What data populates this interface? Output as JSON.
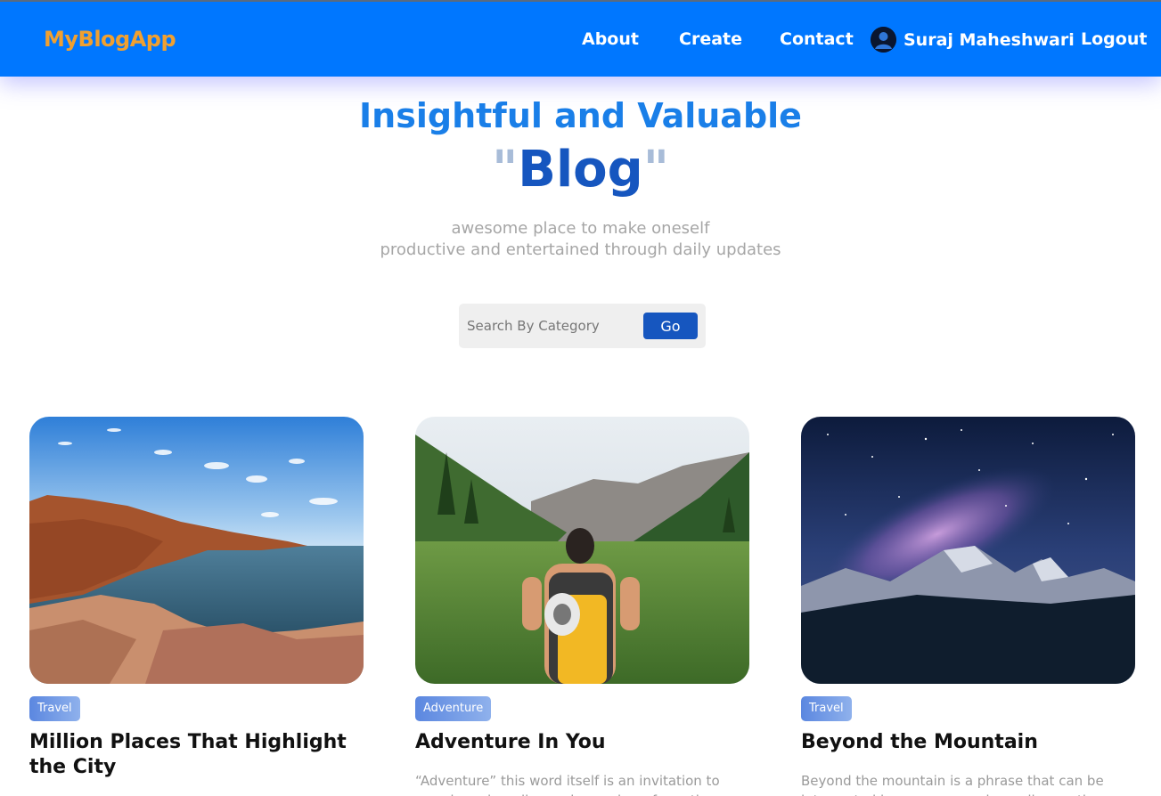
{
  "navbar": {
    "brand": "MyBlogApp",
    "links": {
      "about": "About",
      "create": "Create",
      "contact": "Contact",
      "logout": "Logout"
    },
    "user": {
      "name": "Suraj Maheshwari",
      "icon": "user-avatar-icon"
    }
  },
  "hero": {
    "title": "Insightful and Valuable",
    "highlight_open_quote": "\"",
    "highlight": "Blog",
    "highlight_close_quote": "\"",
    "subtitle_line1": "awesome place to make oneself",
    "subtitle_line2": "productive and entertained through daily updates"
  },
  "search": {
    "placeholder": "Search By Category",
    "value": "",
    "button_label": "Go"
  },
  "posts": [
    {
      "category": "Travel",
      "title": "Million Places That Highlight the City",
      "excerpt": ""
    },
    {
      "category": "Adventure",
      "title": "Adventure In You",
      "excerpt": "“Adventure” this word itself is an invitation to massive adrenaline rush, number of emotions"
    },
    {
      "category": "Travel",
      "title": "Beyond the Mountain",
      "excerpt": "Beyond the mountain is a phrase that can be interpreted in many ways, depending on the"
    }
  ],
  "colors": {
    "navbar": "#0077ff",
    "brand": "#f0a030",
    "accent": "#1656bf",
    "title": "#1a7fe8"
  }
}
